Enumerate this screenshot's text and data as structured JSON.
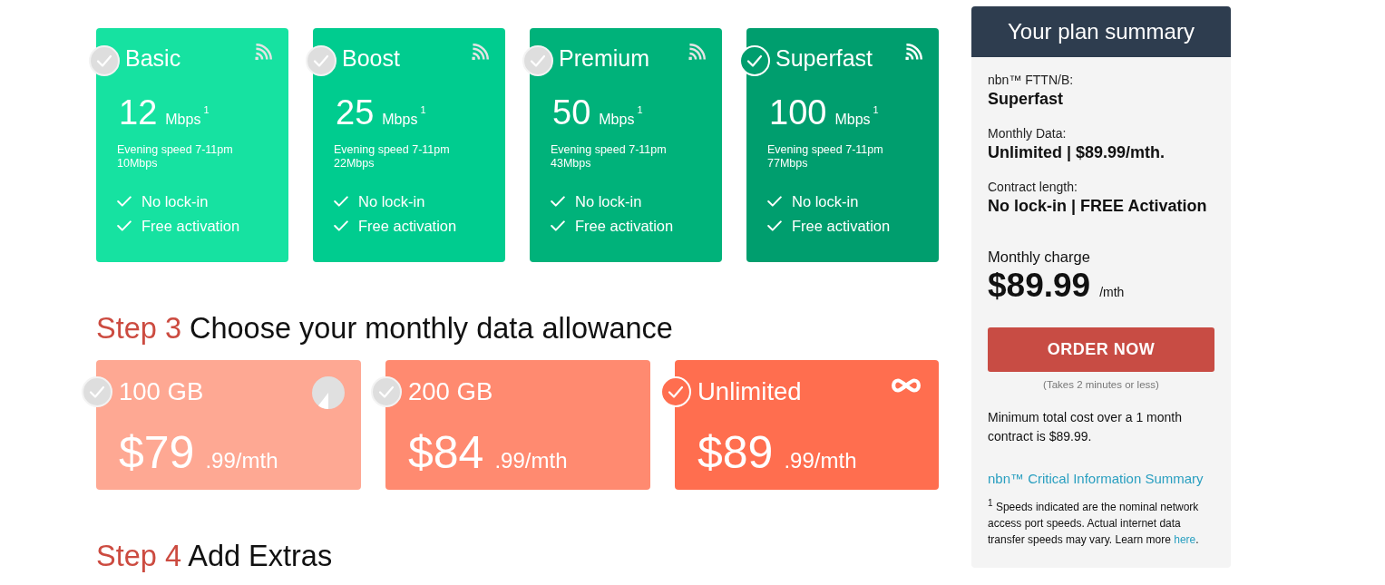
{
  "speeds": [
    {
      "name": "Basic",
      "speed": "12",
      "unit": "Mbps",
      "note": "1",
      "evening_label": "Evening speed 7-11pm",
      "evening_speed": "10Mbps",
      "features": [
        "No lock-in",
        "Free activation"
      ],
      "color": "#16e2a1",
      "selected": false
    },
    {
      "name": "Boost",
      "speed": "25",
      "unit": "Mbps",
      "note": "1",
      "evening_label": "Evening speed 7-11pm",
      "evening_speed": "22Mbps",
      "features": [
        "No lock-in",
        "Free activation"
      ],
      "color": "#00cc8f",
      "selected": false
    },
    {
      "name": "Premium",
      "speed": "50",
      "unit": "Mbps",
      "note": "1",
      "evening_label": "Evening speed 7-11pm",
      "evening_speed": "43Mbps",
      "features": [
        "No lock-in",
        "Free activation"
      ],
      "color": "#00b27a",
      "selected": false
    },
    {
      "name": "Superfast",
      "speed": "100",
      "unit": "Mbps",
      "note": "1",
      "evening_label": "Evening speed 7-11pm",
      "evening_speed": "77Mbps",
      "features": [
        "No lock-in",
        "Free activation"
      ],
      "color": "#009e6e",
      "selected": true
    }
  ],
  "step3": {
    "step": "Step 3",
    "title": "Choose your monthly data allowance"
  },
  "data_plans": [
    {
      "name": "100 GB",
      "price": "$79",
      "cents": ".99/mth",
      "kind": "pie",
      "color": "#fea893",
      "selected": false
    },
    {
      "name": "200 GB",
      "price": "$84",
      "cents": ".99/mth",
      "kind": "plain",
      "color": "#ff8a70",
      "selected": false
    },
    {
      "name": "Unlimited",
      "price": "$89",
      "cents": ".99/mth",
      "kind": "infinity",
      "color": "#ff6e4f",
      "selected": true
    }
  ],
  "step4": {
    "step": "Step 4",
    "title": "Add Extras"
  },
  "summary": {
    "title": "Your plan summary",
    "items": [
      {
        "label": "nbn™ FTTN/B:",
        "value": "Superfast"
      },
      {
        "label": "Monthly Data:",
        "value": "Unlimited | $89.99/mth."
      },
      {
        "label": "Contract length:",
        "value": "No lock-in | FREE Activation"
      }
    ],
    "charge_label": "Monthly charge",
    "charge": "$89.99",
    "charge_unit": "/mth",
    "button": "ORDER NOW",
    "button_note": "(Takes 2 minutes or less)",
    "minimum": "Minimum total cost over a 1 month contract is $89.99.",
    "cis_link": "nbn™ Critical Information Summary",
    "footnote": {
      "text": "$^{1}$ Speeds indicated are the nominal network access port speeds. Actual internet data transfer speeds may vary. Learn more ",
      "link": "here",
      "after": "."
    }
  }
}
